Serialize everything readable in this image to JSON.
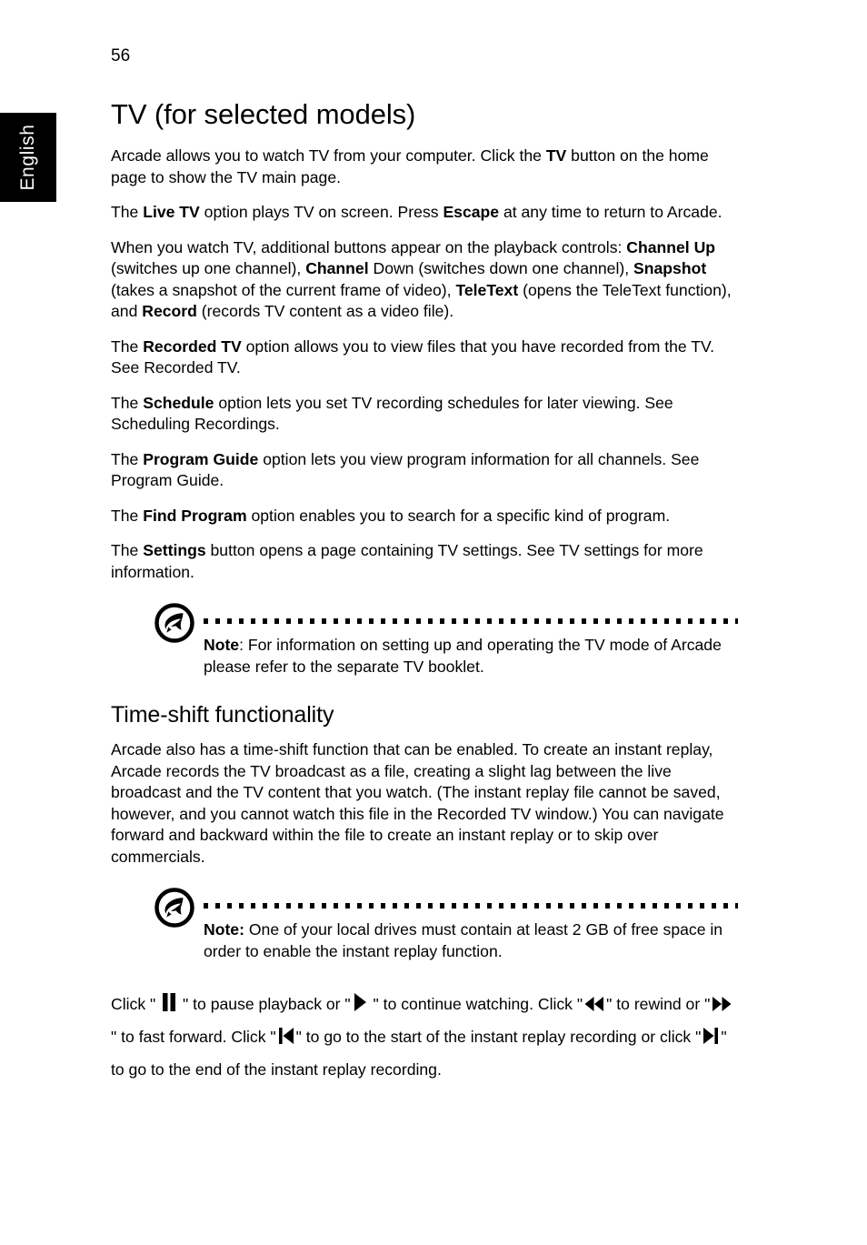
{
  "page": {
    "folio": "56",
    "language_tab": "English"
  },
  "chapter": {
    "title": "TV (for selected models)",
    "paragraphs": [
      {
        "id": "p-intro",
        "runs": [
          {
            "t": "Arcade allows you to watch TV from your computer. Click the ",
            "b": false
          },
          {
            "t": "TV",
            "b": true
          },
          {
            "t": " button on the home page to show the TV main page.",
            "b": false
          }
        ]
      },
      {
        "id": "p-livetv",
        "runs": [
          {
            "t": "The ",
            "b": false
          },
          {
            "t": "Live TV",
            "b": true
          },
          {
            "t": " option plays TV on screen. Press ",
            "b": false
          },
          {
            "t": "Escape",
            "b": true
          },
          {
            "t": " at any time to return to Arcade.",
            "b": false
          }
        ]
      },
      {
        "id": "p-playback-buttons",
        "runs": [
          {
            "t": "When you watch TV, additional buttons appear on the playback controls: ",
            "b": false
          },
          {
            "t": "Channel Up",
            "b": true
          },
          {
            "t": " (switches up one channel), ",
            "b": false
          },
          {
            "t": "Channel",
            "b": true
          },
          {
            "t": " Down (switches down one channel), ",
            "b": false
          },
          {
            "t": "Snapshot",
            "b": true
          },
          {
            "t": " (takes a snapshot of the current frame of video), ",
            "b": false
          },
          {
            "t": "TeleText",
            "b": true
          },
          {
            "t": " (opens the TeleText function), and ",
            "b": false
          },
          {
            "t": "Record",
            "b": true
          },
          {
            "t": " (records TV content as a video file).",
            "b": false
          }
        ]
      },
      {
        "id": "p-recorded-tv",
        "runs": [
          {
            "t": "The ",
            "b": false
          },
          {
            "t": "Recorded TV",
            "b": true
          },
          {
            "t": " option allows you to view files that you have recorded from the TV. See Recorded TV.",
            "b": false
          }
        ]
      },
      {
        "id": "p-schedule",
        "runs": [
          {
            "t": "The ",
            "b": false
          },
          {
            "t": "Schedule",
            "b": true
          },
          {
            "t": " option lets you set TV recording schedules for later viewing. See Scheduling Recordings.",
            "b": false
          }
        ]
      },
      {
        "id": "p-program-guide",
        "runs": [
          {
            "t": "The ",
            "b": false
          },
          {
            "t": "Program Guide",
            "b": true
          },
          {
            "t": " option lets you view program information for all channels. See Program Guide.",
            "b": false
          }
        ]
      },
      {
        "id": "p-find-program",
        "runs": [
          {
            "t": "The ",
            "b": false
          },
          {
            "t": "Find Program",
            "b": true
          },
          {
            "t": " option enables you to search for a specific kind of program.",
            "b": false
          }
        ]
      },
      {
        "id": "p-settings",
        "runs": [
          {
            "t": "The ",
            "b": false
          },
          {
            "t": "Settings",
            "b": true
          },
          {
            "t": " button opens a page containing TV settings. See TV settings for more information.",
            "b": false
          }
        ]
      }
    ]
  },
  "note_tv": {
    "icon": "acer-note-icon",
    "runs": [
      {
        "t": "Note",
        "b": true
      },
      {
        "t": ": For information on setting up and operating the TV mode of Arcade please refer to the separate TV booklet.",
        "b": false
      }
    ]
  },
  "section_timeshift": {
    "title": "Time-shift functionality",
    "paragraphs": [
      {
        "id": "p-timeshift-intro",
        "runs": [
          {
            "t": "Arcade also has a time-shift function that can be enabled. To create an instant replay, Arcade records the TV broadcast as a file, creating a slight lag between the live broadcast and the TV content that you watch. (The instant replay file cannot be saved, however, and you cannot watch this file in the Recorded TV window.) You can navigate forward and backward within the file to create an instant replay or to skip over commercials.",
            "b": false
          }
        ]
      }
    ]
  },
  "note_diskspace": {
    "icon": "acer-note-icon",
    "runs": [
      {
        "t": "Note:",
        "b": true
      },
      {
        "t": " One of your local drives must contain at least 2 GB of free space in order to enable the instant replay function.",
        "b": false
      }
    ]
  },
  "playback_paragraph": {
    "segments": [
      {
        "kind": "text",
        "t": "Click \" "
      },
      {
        "kind": "icon",
        "name": "pause-icon"
      },
      {
        "kind": "text",
        "t": " \" to pause playback or \""
      },
      {
        "kind": "icon",
        "name": "play-icon"
      },
      {
        "kind": "text",
        "t": " \" to continue watching. Click \""
      },
      {
        "kind": "icon",
        "name": "rewind-icon"
      },
      {
        "kind": "text",
        "t": "\" to rewind or \""
      },
      {
        "kind": "icon",
        "name": "fast-forward-icon"
      },
      {
        "kind": "text",
        "t": " \" to fast forward. Click \""
      },
      {
        "kind": "icon",
        "name": "skip-to-start-icon"
      },
      {
        "kind": "text",
        "t": "\" to go to the start of the instant replay recording or click \""
      },
      {
        "kind": "icon",
        "name": "skip-to-end-icon"
      },
      {
        "kind": "text",
        "t": "\" to go to the end of the instant replay recording."
      }
    ]
  },
  "colors": {
    "page_background": "#ffffff",
    "text": "#000000",
    "tab_background": "#000000",
    "tab_text": "#ffffff"
  }
}
